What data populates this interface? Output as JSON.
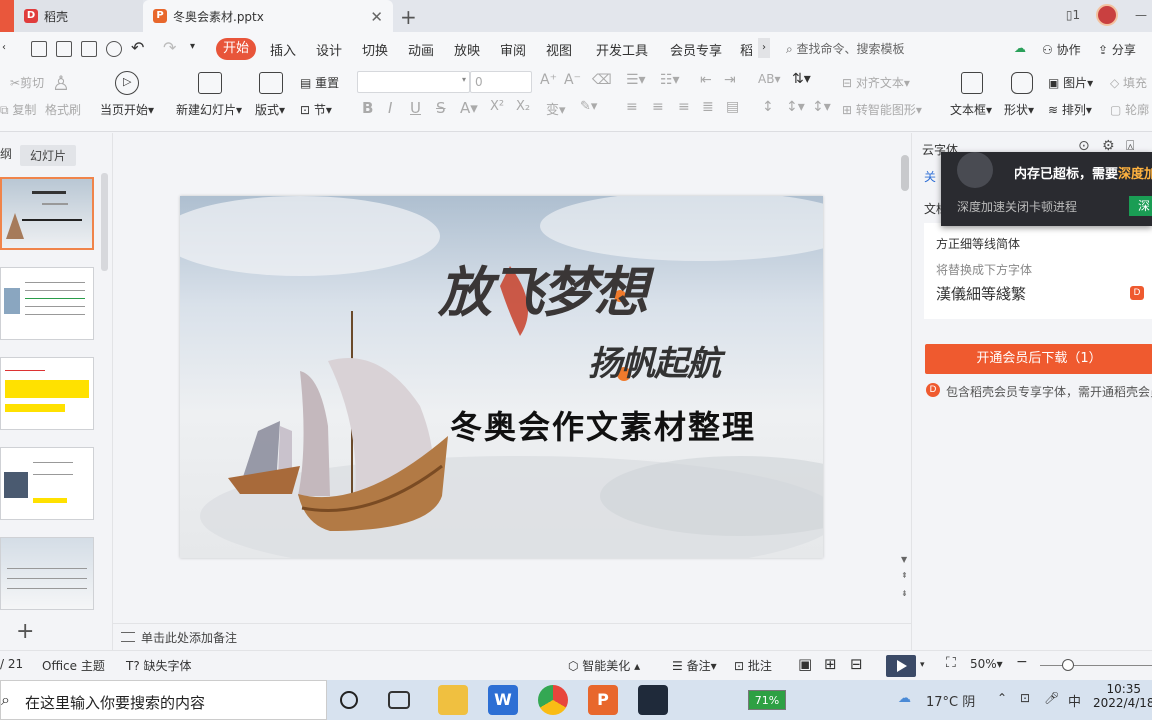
{
  "tabs": {
    "docer": "稻壳",
    "pptx": "冬奥会素材.pptx"
  },
  "menu": {
    "items": [
      "开始",
      "插入",
      "设计",
      "切换",
      "动画",
      "放映",
      "审阅",
      "视图",
      "开发工具",
      "会员专享",
      "稻"
    ],
    "search_placeholder": "查找命令、搜索模板",
    "collab": "协作",
    "share": "分享"
  },
  "ribbon": {
    "cut": "剪切",
    "copy": "复制",
    "format_painter": "格式刷",
    "play_current": "当页开始",
    "new_slide": "新建幻灯片",
    "layout": "版式",
    "reset": "重置",
    "section": "节",
    "font_size": "0",
    "align_text": "对齐文本",
    "smartart": "转智能图形",
    "textbox": "文本框",
    "shape": "形状",
    "picture": "图片",
    "arrange": "排列",
    "fill": "填充",
    "outline": "轮廓"
  },
  "thumbs_panel": {
    "outline_tab": "纲",
    "slides_tab": "幻灯片"
  },
  "slide": {
    "title": "放飞梦想",
    "subtitle": "扬帆起航",
    "main": "冬奥会作文素材整理"
  },
  "notes": {
    "placeholder": "单击此处添加备注"
  },
  "right_panel": {
    "header": "云字体",
    "close_link": "关",
    "doc_label": "文档",
    "font_missing": "方正细等线简体",
    "replace_hint": "将替换成下方字体",
    "replace_font": "漢儀細等綫繁",
    "download_btn": "开通会员后下载（1）",
    "member_note": "包含稻壳会员专享字体，需开通稻壳会员"
  },
  "memory_popup": {
    "title": "内存已超标，需要",
    "title_accent": "深度加",
    "subtitle": "深度加速关闭卡顿进程",
    "button": "深"
  },
  "statusbar": {
    "page": "/ 21",
    "theme": "Office 主题",
    "missing_font": "缺失字体",
    "beautify": "智能美化",
    "notes": "备注",
    "comment": "批注",
    "zoom": "50%"
  },
  "taskbar": {
    "search": "在这里输入你要搜索的内容",
    "battery": "71%",
    "weather": "17°C 阴",
    "ime": "中",
    "time": "10:35",
    "date": "2022/4/18"
  },
  "colors": {
    "accent": "#e8553a",
    "download": "#ef5a2f",
    "popup_bg": "#2a2b30",
    "play": "#3b4a67"
  }
}
